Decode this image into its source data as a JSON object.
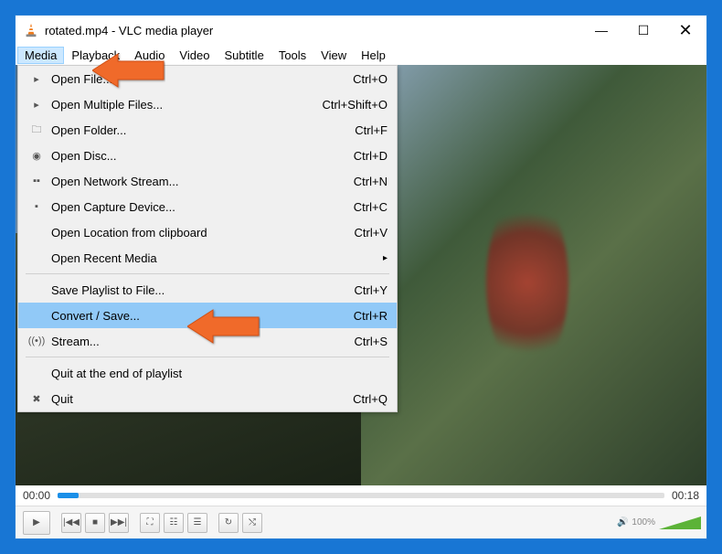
{
  "window": {
    "title": "rotated.mp4 - VLC media player"
  },
  "menubar": {
    "items": [
      "Media",
      "Playback",
      "Audio",
      "Video",
      "Subtitle",
      "Tools",
      "View",
      "Help"
    ]
  },
  "dropdown": {
    "items": [
      {
        "icon": "▸",
        "label": "Open File...",
        "shortcut": "Ctrl+O"
      },
      {
        "icon": "▸",
        "label": "Open Multiple Files...",
        "shortcut": "Ctrl+Shift+O"
      },
      {
        "icon": "🗀",
        "label": "Open Folder...",
        "shortcut": "Ctrl+F"
      },
      {
        "icon": "◉",
        "label": "Open Disc...",
        "shortcut": "Ctrl+D"
      },
      {
        "icon": "▪▪",
        "label": "Open Network Stream...",
        "shortcut": "Ctrl+N"
      },
      {
        "icon": "▪",
        "label": "Open Capture Device...",
        "shortcut": "Ctrl+C"
      },
      {
        "icon": "",
        "label": "Open Location from clipboard",
        "shortcut": "Ctrl+V"
      },
      {
        "icon": "",
        "label": "Open Recent Media",
        "shortcut": "",
        "submenu": true
      }
    ],
    "items2": [
      {
        "icon": "",
        "label": "Save Playlist to File...",
        "shortcut": "Ctrl+Y"
      },
      {
        "icon": "",
        "label": "Convert / Save...",
        "shortcut": "Ctrl+R",
        "highlight": true
      },
      {
        "icon": "((•))",
        "label": "Stream...",
        "shortcut": "Ctrl+S"
      }
    ],
    "items3": [
      {
        "icon": "",
        "label": "Quit at the end of playlist",
        "shortcut": ""
      },
      {
        "icon": "✖",
        "label": "Quit",
        "shortcut": "Ctrl+Q"
      }
    ]
  },
  "time": {
    "current": "00:00",
    "total": "00:18"
  },
  "volume": {
    "percent": "100%"
  }
}
